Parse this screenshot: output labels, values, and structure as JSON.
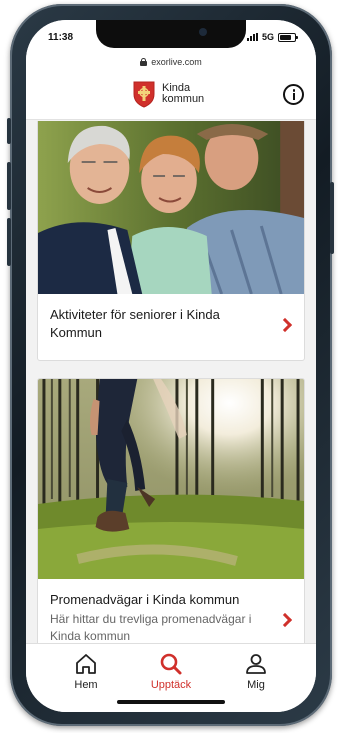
{
  "status_bar": {
    "time": "11:38",
    "network": "5G",
    "battery_level": 0.8
  },
  "browser": {
    "url": "exorlive.com"
  },
  "header": {
    "brand_line1": "Kinda",
    "brand_line2": "kommun",
    "crest_icon": "kinda-crest-icon",
    "info_icon": "info-icon"
  },
  "cards": [
    {
      "title": "Aktiviteter för seniorer i Kinda Kommun",
      "description": ""
    },
    {
      "title": "Promenadvägar i Kinda kommun",
      "description": "Här hittar du trevliga promenadvägar i Kinda kommun"
    }
  ],
  "tabs": [
    {
      "label": "Hem",
      "icon": "home-icon",
      "active": false
    },
    {
      "label": "Upptäck",
      "icon": "search-icon",
      "active": true
    },
    {
      "label": "Mig",
      "icon": "user-icon",
      "active": false
    }
  ],
  "colors": {
    "accent": "#d0302b",
    "background": "#f2f2f2",
    "card": "#ffffff"
  }
}
